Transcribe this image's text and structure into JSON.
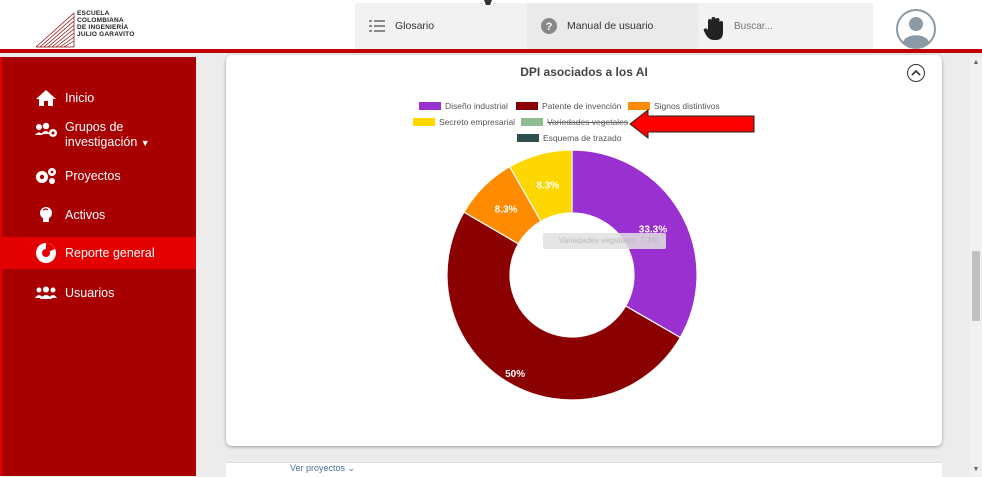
{
  "header": {
    "logo_lines": [
      "ESCUELA",
      "COLOMBIANA",
      "DE INGENIERÍA",
      "JULIO GARAVITO"
    ],
    "nav": {
      "glossary_label": "Glosario",
      "manual_label": "Manual de usuario",
      "search_placeholder": "Buscar..."
    }
  },
  "sidebar": {
    "items": [
      {
        "label": "Inicio",
        "icon": "home-icon"
      },
      {
        "label": "Grupos de investigación",
        "icon": "users-cog-icon"
      },
      {
        "label": "Proyectos",
        "icon": "gears-icon"
      },
      {
        "label": "Activos",
        "icon": "lightbulb-icon"
      },
      {
        "label": "Reporte general",
        "icon": "pie-chart-icon",
        "active": true
      },
      {
        "label": "Usuarios",
        "icon": "users-icon"
      }
    ]
  },
  "main": {
    "bottom_link": "Ver proyectos"
  },
  "chart_data": {
    "type": "pie",
    "title": "DPI asociados a los AI",
    "donut": true,
    "categories": [
      "Diseño industrial",
      "Patente de invención",
      "Signos distintivos",
      "Secreto empresarial",
      "Variedades vegetales",
      "Esquema de trazado"
    ],
    "values": [
      33.3,
      50,
      8.3,
      8.3,
      0,
      0
    ],
    "value_labels": [
      "33.3%",
      "50%",
      "8.3%",
      "8.3%",
      "",
      ""
    ],
    "colors": [
      "#9b30d0",
      "#8b0000",
      "#ff8c00",
      "#ffd700",
      "#8fbc8f",
      "#2f4f4f"
    ],
    "hidden": [
      false,
      false,
      false,
      false,
      true,
      false
    ],
    "legend_position": "top",
    "tooltip_text": "Variedades vegetales: 7.7%"
  }
}
